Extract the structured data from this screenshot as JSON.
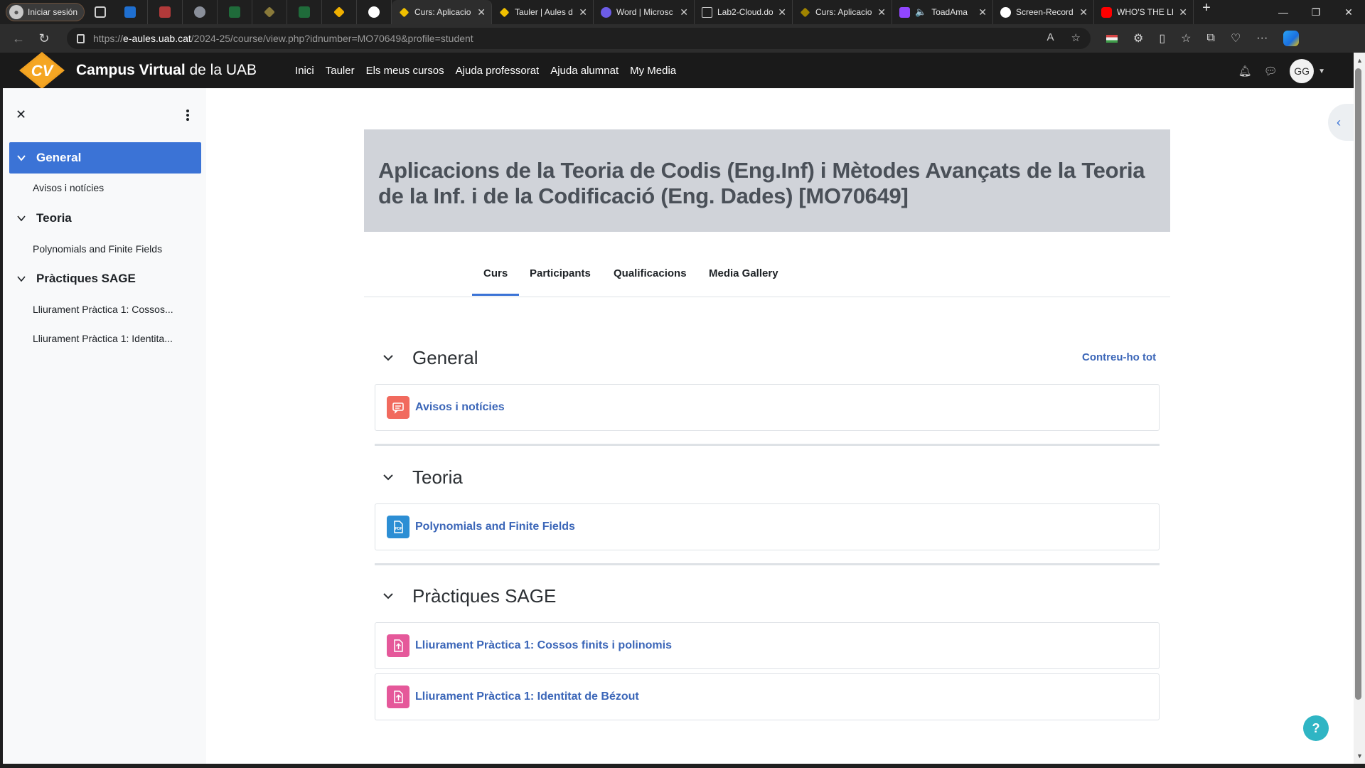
{
  "browser": {
    "profile_label": "Iniciar sesión",
    "tabs": [
      {
        "title": "Curs: Aplicacio",
        "active": true,
        "color": "#f0c000"
      },
      {
        "title": "Tauler | Aules d",
        "active": false,
        "color": "#f0c000"
      },
      {
        "title": "Word | Microsc",
        "active": false,
        "color": "#6c5ce7"
      },
      {
        "title": "Lab2-Cloud.do",
        "active": false,
        "color": "#cfcfcf"
      },
      {
        "title": "Curs: Aplicacio",
        "active": false,
        "color": "#d8a800"
      },
      {
        "title": "ToadAma",
        "active": false,
        "color": "#9146ff"
      },
      {
        "title": "Screen-Record",
        "active": false,
        "color": "#ffffff"
      },
      {
        "title": "WHO'S THE LI",
        "active": false,
        "color": "#ff0000"
      }
    ],
    "url_prefix": "https://",
    "url_host": "e-aules.uab.cat",
    "url_path": "/2024-25/course/view.php?idnumber=MO70649&profile=student"
  },
  "site": {
    "logo_text": "CV",
    "name_bold": "Campus Virtual",
    "name_rest": " de la UAB",
    "nav_links": [
      "Inici",
      "Tauler",
      "Els meus cursos",
      "Ajuda professorat",
      "Ajuda alumnat",
      "My Media"
    ],
    "user_initials": "GG"
  },
  "course_index": {
    "sections": [
      {
        "label": "General",
        "active": true,
        "items": [
          "Avisos i notícies"
        ]
      },
      {
        "label": "Teoria",
        "active": false,
        "items": [
          "Polynomials and Finite Fields"
        ]
      },
      {
        "label": "Pràctiques SAGE",
        "active": false,
        "items": [
          "Lliurament Pràctica 1: Cossos...",
          "Lliurament Pràctica 1: Identita..."
        ]
      }
    ]
  },
  "course": {
    "title": "Aplicacions de la Teoria de Codis (Eng.Inf) i Mètodes Avançats de la Teoria de la Inf. i de la Codificació (Eng. Dades) [MO70649]",
    "tabs": [
      "Curs",
      "Participants",
      "Qualificacions",
      "Media Gallery"
    ],
    "active_tab": "Curs",
    "collapse_all": "Contreu-ho tot",
    "sections": [
      {
        "title": "General",
        "activities": [
          {
            "name": "Avisos i notícies",
            "icon": "forum-icon",
            "color": "#f16a5e"
          }
        ]
      },
      {
        "title": "Teoria",
        "activities": [
          {
            "name": "Polynomials and Finite Fields",
            "icon": "pdf-file-icon",
            "color": "#2c8ed4"
          }
        ]
      },
      {
        "title": "Pràctiques SAGE",
        "activities": [
          {
            "name": "Lliurament Pràctica 1: Cossos finits i polinomis",
            "icon": "assignment-icon",
            "color": "#e5589a"
          },
          {
            "name": "Lliurament Pràctica 1: Identitat de Bézout",
            "icon": "assignment-icon",
            "color": "#e5589a"
          }
        ]
      }
    ]
  },
  "help_label": "?",
  "colors": {
    "accent": "#3b73d6",
    "link": "#3b66b8",
    "header_bg": "#d0d3d9",
    "nav_bg": "#1a1a1a"
  }
}
